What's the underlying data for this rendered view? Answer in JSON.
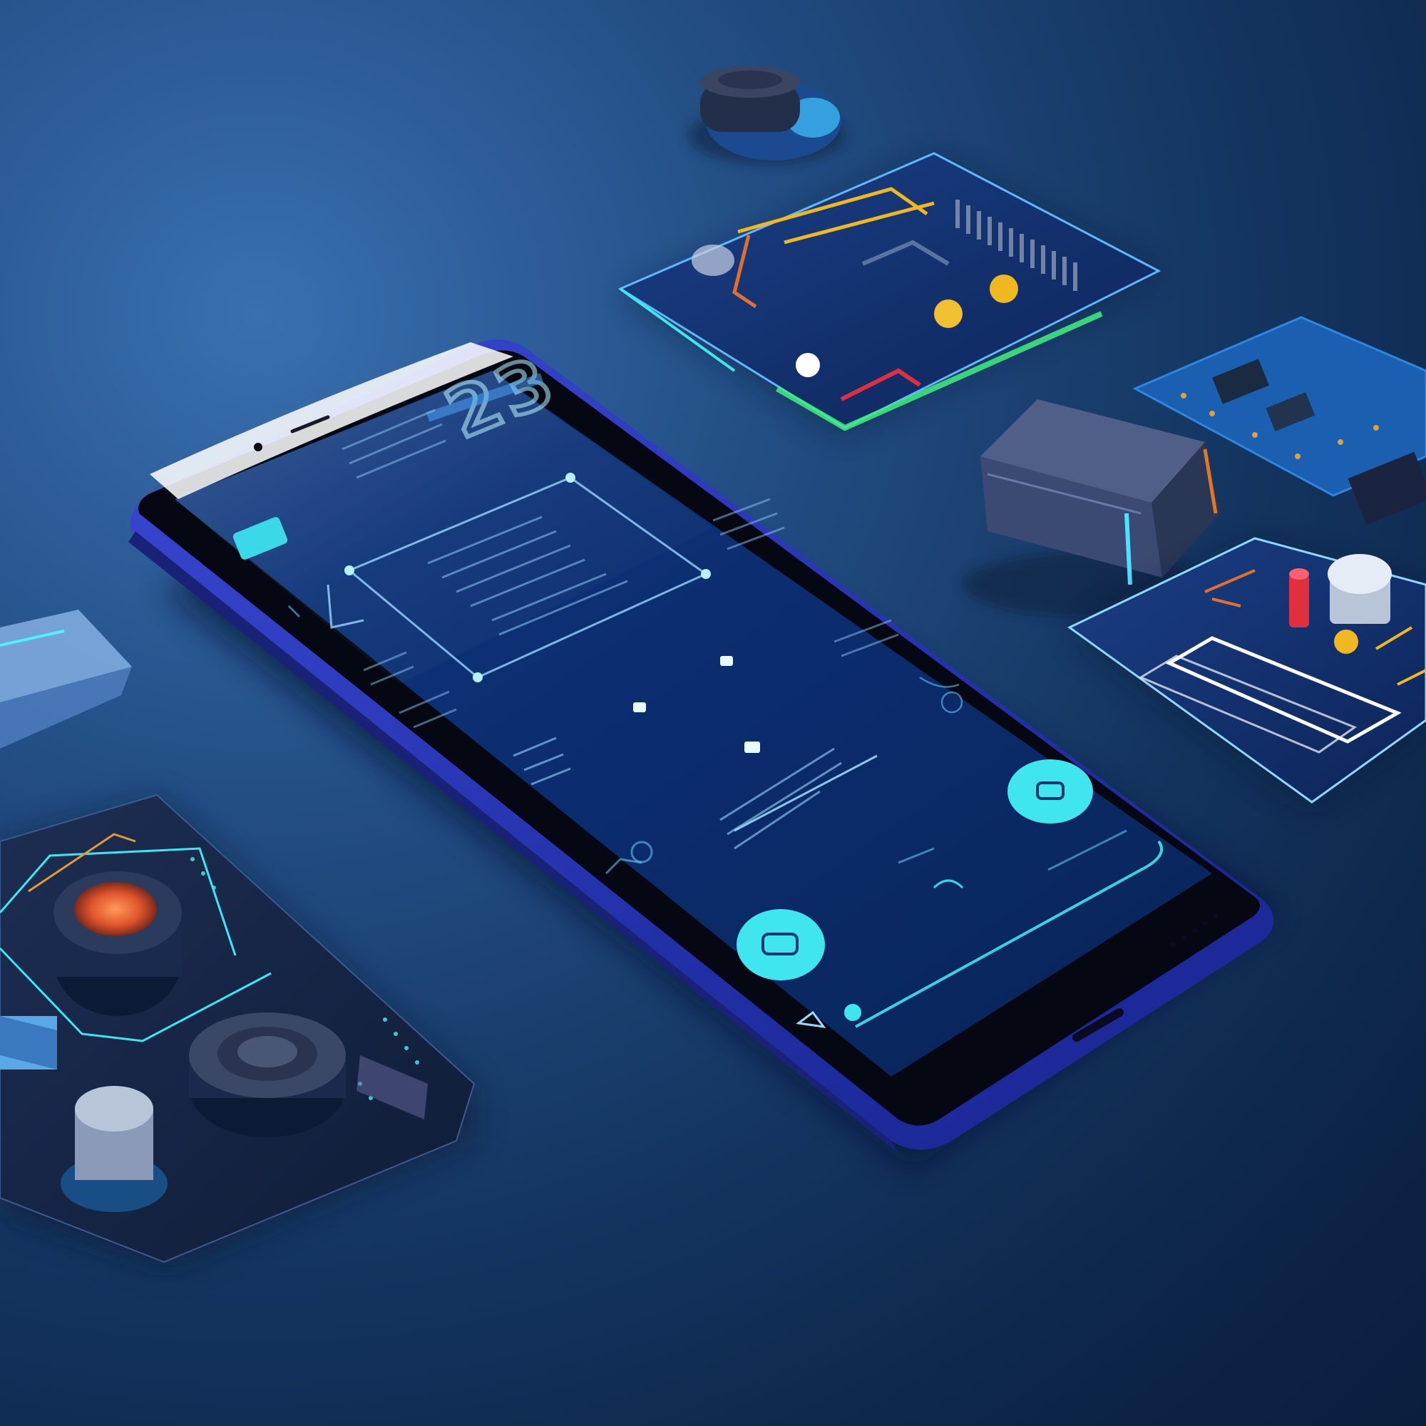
{
  "scene": "smartphone-with-futuristic-ui-among-hardware-props",
  "phone": {
    "screen_big_number": "23"
  },
  "colors": {
    "background": "#143560",
    "phone_frame": "#2a36b8",
    "screen": "#0d2a6b",
    "accent_cyan": "#3fe6f0",
    "glow_green": "#38f08a",
    "accent_orange": "#e07030",
    "accent_yellow": "#f0b820",
    "accent_red": "#e03040"
  },
  "icons": [
    "chat-bubble-icon",
    "home-icon",
    "indicator-dot-icon"
  ]
}
